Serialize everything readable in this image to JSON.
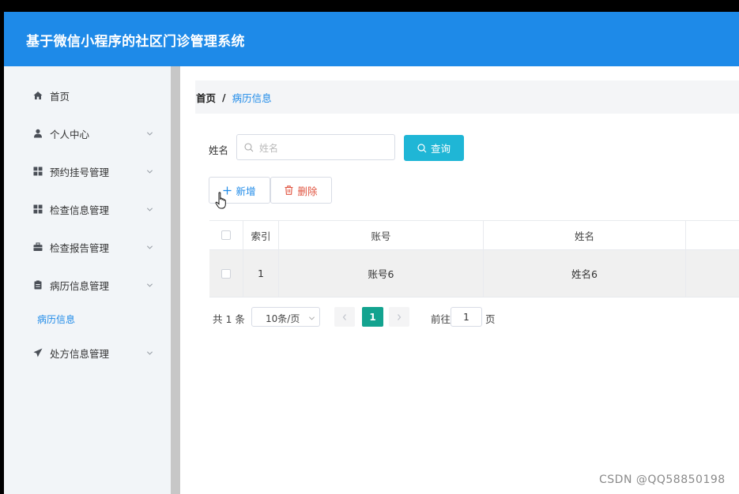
{
  "header": {
    "title": "基于微信小程序的社区门诊管理系统"
  },
  "sidebar": {
    "items": [
      {
        "label": "首页",
        "icon": "home-icon"
      },
      {
        "label": "个人中心",
        "icon": "user-icon"
      },
      {
        "label": "预约挂号管理",
        "icon": "grid-icon"
      },
      {
        "label": "检查信息管理",
        "icon": "grid-icon"
      },
      {
        "label": "检查报告管理",
        "icon": "briefcase-icon"
      },
      {
        "label": "病历信息管理",
        "icon": "clipboard-icon"
      },
      {
        "label": "处方信息管理",
        "icon": "send-icon"
      }
    ],
    "sub_item": "病历信息"
  },
  "breadcrumb": {
    "home": "首页",
    "separator": "/",
    "current": "病历信息"
  },
  "search": {
    "label": "姓名",
    "placeholder": "姓名",
    "value": "",
    "button": "查询"
  },
  "actions": {
    "add": "新增",
    "delete": "删除"
  },
  "table": {
    "columns": [
      "索引",
      "账号",
      "姓名"
    ],
    "rows": [
      {
        "index": "1",
        "account": "账号6",
        "name": "姓名6"
      }
    ]
  },
  "pagination": {
    "total": "共 1 条",
    "page_size": "10条/页",
    "current_page": "1",
    "goto_label": "前往",
    "goto_value": "1",
    "page_suffix": "页"
  },
  "watermark": "CSDN @QQ58850198",
  "colors": {
    "header": "#1e8ae8",
    "query_button": "#1fb6d6",
    "active_page": "#13a38f",
    "delete": "#e0533f"
  }
}
